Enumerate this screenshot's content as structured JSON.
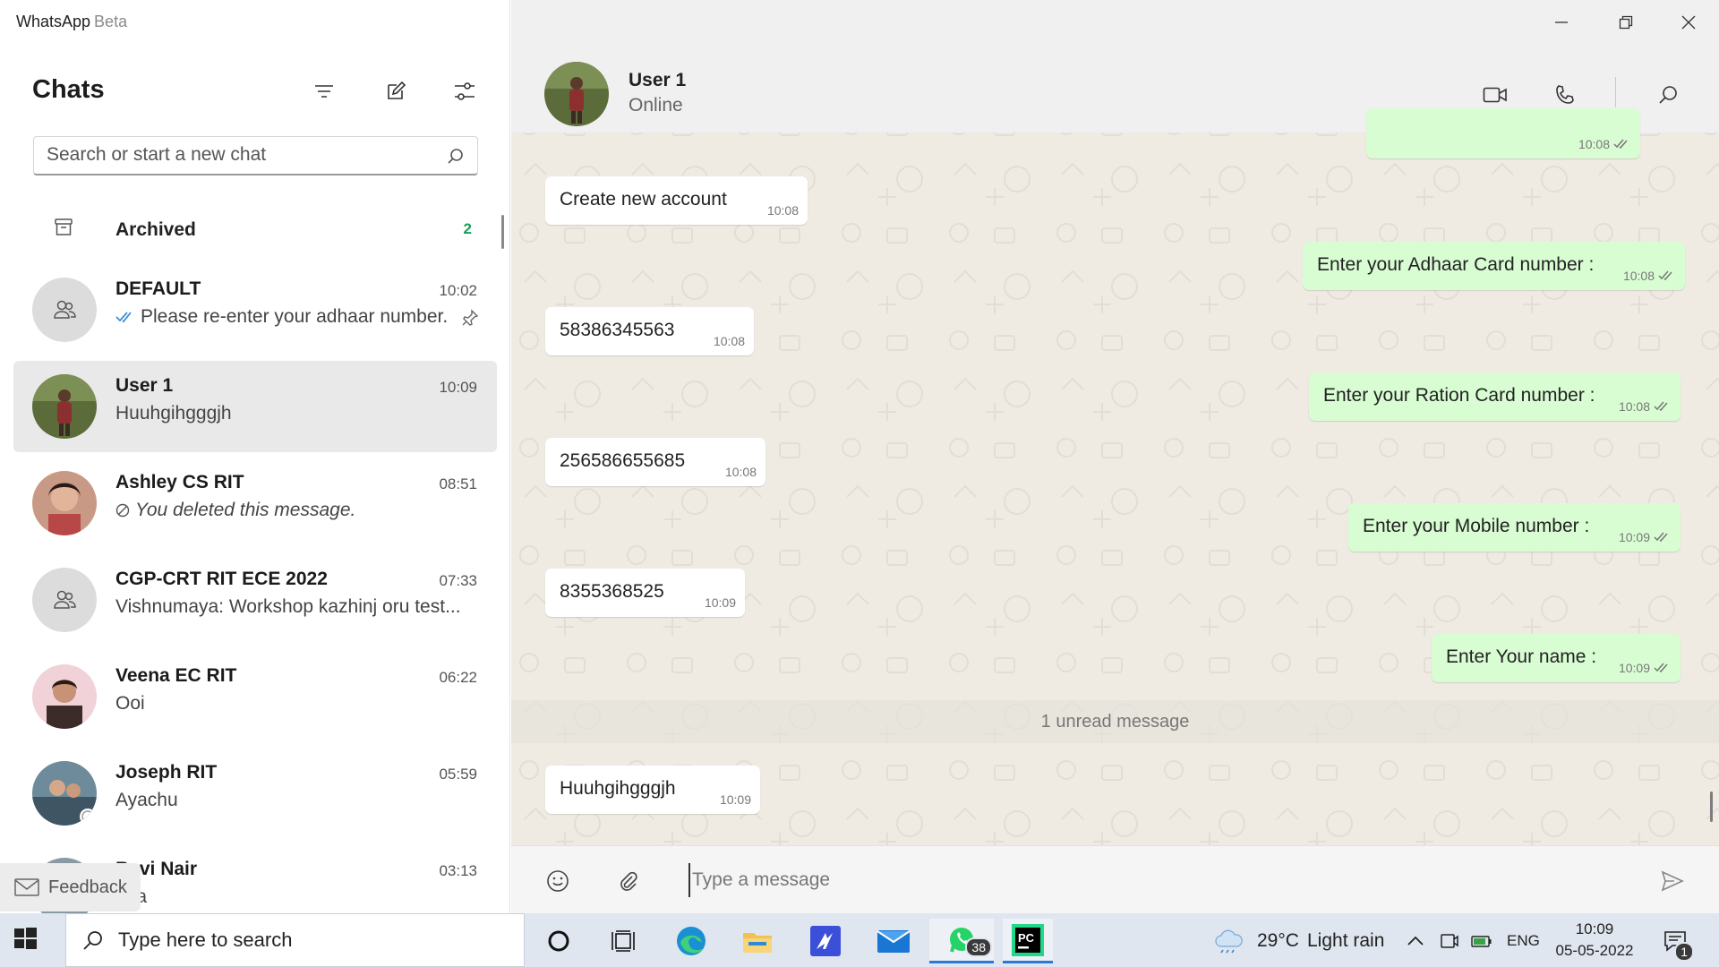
{
  "app": {
    "title": "WhatsApp",
    "subtitle": "Beta"
  },
  "sidebar": {
    "heading": "Chats",
    "search_placeholder": "Search or start a new chat",
    "archived": {
      "label": "Archived",
      "count": "2"
    },
    "chats": [
      {
        "name": "DEFAULT",
        "time": "10:02",
        "preview": "Please re-enter your adhaar number.",
        "type": "group",
        "read_ticks": true,
        "pinned": true
      },
      {
        "name": "User 1",
        "time": "10:09",
        "preview": "Huuhgihgggjh",
        "type": "photo",
        "selected": true
      },
      {
        "name": "Ashley CS RIT",
        "time": "08:51",
        "preview": "You deleted this message.",
        "type": "photo",
        "deleted": true
      },
      {
        "name": "CGP-CRT RIT ECE 2022",
        "time": "07:33",
        "preview": "Vishnumaya: Workshop kazhinj oru test...",
        "type": "group"
      },
      {
        "name": "Veena EC RIT",
        "time": "06:22",
        "preview": "Ooi",
        "type": "photo"
      },
      {
        "name": "Joseph RIT",
        "time": "05:59",
        "preview": "Ayachu",
        "type": "photo"
      },
      {
        "name": "Ravi Nair",
        "time": "03:13",
        "preview": "aha",
        "type": "photo"
      }
    ],
    "feedback_label": "Feedback"
  },
  "conversation": {
    "contact_name": "User 1",
    "contact_status": "Online",
    "messages": [
      {
        "direction": "out",
        "text": "",
        "time": "10:08"
      },
      {
        "direction": "in",
        "text": "Create new account",
        "time": "10:08"
      },
      {
        "direction": "out",
        "text": "Enter your Adhaar Card number :",
        "time": "10:08"
      },
      {
        "direction": "in",
        "text": "58386345563",
        "time": "10:08"
      },
      {
        "direction": "out",
        "text": "Enter your Ration Card number :",
        "time": "10:08"
      },
      {
        "direction": "in",
        "text": "256586655685",
        "time": "10:08"
      },
      {
        "direction": "out",
        "text": "Enter your Mobile number :",
        "time": "10:09"
      },
      {
        "direction": "in",
        "text": "8355368525",
        "time": "10:09"
      },
      {
        "direction": "out",
        "text": "Enter Your name :",
        "time": "10:09"
      },
      {
        "direction": "in",
        "text": "Huuhgihgggjh",
        "time": "10:09"
      }
    ],
    "unread_label": "1 unread message",
    "composer_placeholder": "Type a message"
  },
  "taskbar": {
    "search_placeholder": "Type here to search",
    "whatsapp_badge": "38",
    "weather": {
      "temp": "29°C",
      "condition": "Light rain"
    },
    "language": "ENG",
    "clock": {
      "time": "10:09",
      "date": "05-05-2022"
    },
    "notification_count": "1"
  },
  "colors": {
    "accent_green": "#1a9e5a",
    "outgoing_bubble": "#d9fdd3",
    "incoming_bubble": "#ffffff",
    "chat_background": "#efeae2",
    "tick_blue": "#3b8ed8"
  }
}
